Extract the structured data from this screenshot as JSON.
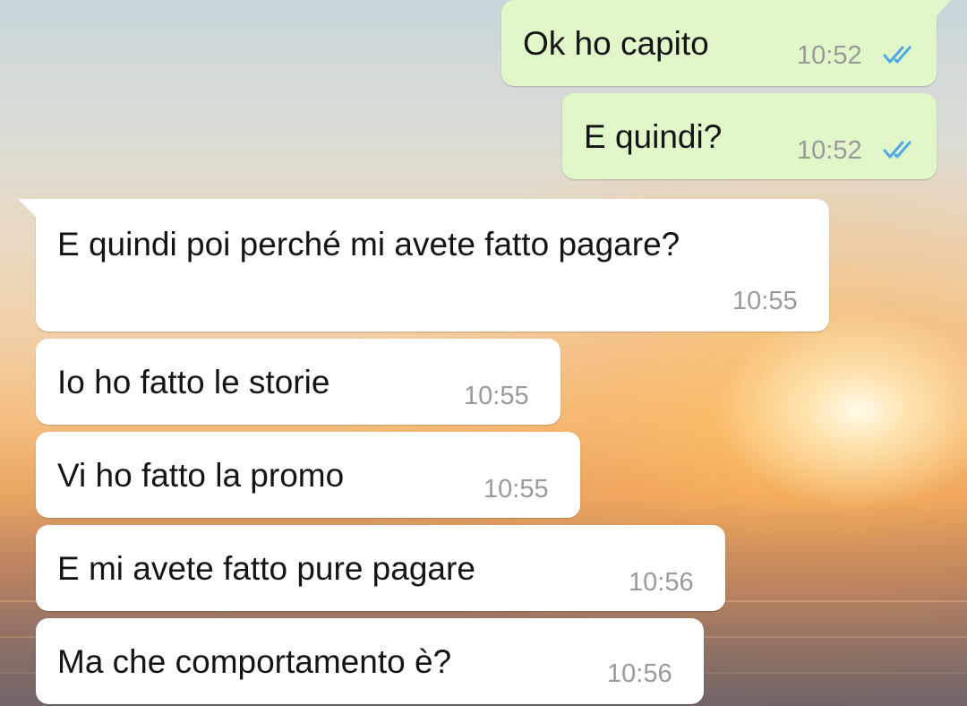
{
  "chat": {
    "messages": [
      {
        "id": "m1",
        "direction": "outgoing",
        "text": "Ok ho capito",
        "time": "10:52",
        "status": "read",
        "status_icon": "double-check-icon"
      },
      {
        "id": "m2",
        "direction": "outgoing",
        "text": "E quindi?",
        "time": "10:52",
        "status": "read",
        "status_icon": "double-check-icon"
      },
      {
        "id": "m3",
        "direction": "incoming",
        "text": "E quindi poi perché mi avete fatto pagare?",
        "time": "10:55"
      },
      {
        "id": "m4",
        "direction": "incoming",
        "text": "Io ho fatto le storie",
        "time": "10:55"
      },
      {
        "id": "m5",
        "direction": "incoming",
        "text": "Vi ho fatto la promo",
        "time": "10:55"
      },
      {
        "id": "m6",
        "direction": "incoming",
        "text": "E mi avete fatto pure pagare",
        "time": "10:56"
      },
      {
        "id": "m7",
        "direction": "incoming",
        "text": "Ma che comportamento è?",
        "time": "10:56"
      }
    ]
  },
  "colors": {
    "outgoing_bubble": "#e1f7c9",
    "incoming_bubble": "#ffffff",
    "read_ticks": "#4fa8e6",
    "timestamp": "#9a9a9a"
  }
}
